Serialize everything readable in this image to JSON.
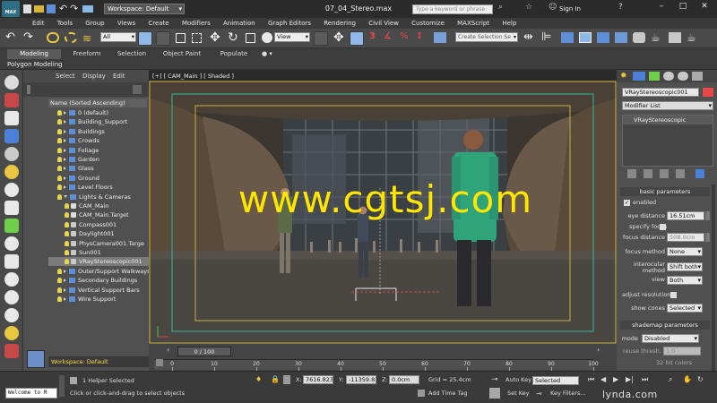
{
  "titlebar": {
    "app": "MAX",
    "workspace": "Workspace: Default",
    "filename": "07_04_Stereo.max",
    "search_placeholder": "Type a keyword or phrase",
    "signin": "Sign In"
  },
  "menu": [
    "Edit",
    "Tools",
    "Group",
    "Views",
    "Create",
    "Modifiers",
    "Animation",
    "Graph Editors",
    "Rendering",
    "Civil View",
    "Customize",
    "MAXScript",
    "Help"
  ],
  "toolbar": {
    "filter": "All",
    "refcoord": "View",
    "selset": "Create Selection Se"
  },
  "ribbon": {
    "tabs": [
      "Modeling",
      "Freeform",
      "Selection",
      "Object Paint",
      "Populate"
    ],
    "sub": "Polygon Modeling"
  },
  "explorer": {
    "tabs": [
      "Select",
      "Display",
      "Edit"
    ],
    "header": "Name (Sorted Ascending)",
    "workspace": "Workspace: Default",
    "items": [
      {
        "label": "0 (default)",
        "depth": 1,
        "icon": "layer"
      },
      {
        "label": "Building_Support",
        "depth": 1,
        "icon": "layer"
      },
      {
        "label": "Buildings",
        "depth": 1,
        "icon": "layer"
      },
      {
        "label": "Crowds",
        "depth": 1,
        "icon": "layer"
      },
      {
        "label": "Foliage",
        "depth": 1,
        "icon": "layer"
      },
      {
        "label": "Garden",
        "depth": 1,
        "icon": "layer"
      },
      {
        "label": "Glass",
        "depth": 1,
        "icon": "layer"
      },
      {
        "label": "Ground",
        "depth": 1,
        "icon": "layer"
      },
      {
        "label": "Level Floors",
        "depth": 1,
        "icon": "layer"
      },
      {
        "label": "Lights & Cameras",
        "depth": 1,
        "icon": "layer",
        "open": true
      },
      {
        "label": "CAM_Main",
        "depth": 2,
        "icon": "camera"
      },
      {
        "label": "CAM_Main.Target",
        "depth": 2,
        "icon": "camera"
      },
      {
        "label": "Compass001",
        "depth": 2,
        "icon": "helper"
      },
      {
        "label": "Daylight001",
        "depth": 2,
        "icon": "helper"
      },
      {
        "label": "PhysCamera001.Targe",
        "depth": 2,
        "icon": "helper"
      },
      {
        "label": "Sun001",
        "depth": 2,
        "icon": "helper"
      },
      {
        "label": "VRayStereoscopic001",
        "depth": 2,
        "icon": "helper",
        "selected": true
      },
      {
        "label": "Outer/Support Walkways",
        "depth": 1,
        "icon": "layer"
      },
      {
        "label": "Secondary Buildings",
        "depth": 1,
        "icon": "layer"
      },
      {
        "label": "Vertical Support Bars",
        "depth": 1,
        "icon": "layer"
      },
      {
        "label": "Wire Support",
        "depth": 1,
        "icon": "layer"
      }
    ]
  },
  "viewport": {
    "label": "[+] [ CAM_Main ] [ Shaded ]",
    "watermark": "www.cgtsj.com"
  },
  "panel": {
    "object_name": "VRayStereoscopic001",
    "modifier_list": "Modifier List",
    "stack_item": "VRayStereoscopic",
    "basic_title": "basic parameters",
    "enabled": "enabled",
    "eye_label": "eye distance",
    "eye_value": "16.51cm",
    "specify_focus": "specify focus",
    "focus_label": "focus distance",
    "focus_value": "508.0cm",
    "focus_method_label": "focus method",
    "focus_method": "None",
    "interocular_label": "interocular method",
    "interocular": "Shift both",
    "view_label": "view",
    "view": "Both",
    "adjust_label": "adjust resolution",
    "cones_label": "show cones",
    "cones": "Selected",
    "shademap_title": "shademap parameters",
    "mode_label": "mode",
    "mode": "Disabled",
    "reuse_label": "reuse thresh.",
    "reuse": "1.0",
    "bits": "32 bit colors"
  },
  "timeline": {
    "frame": "0 / 100",
    "ticks": [
      "0",
      "10",
      "20",
      "30",
      "40",
      "50",
      "60",
      "70",
      "80",
      "90",
      "100"
    ]
  },
  "status": {
    "listener": "Welcome to M",
    "selected": "1 Helper Selected",
    "prompt": "Click or click-and-drag to select objects",
    "x_label": "X:",
    "x": "7616.823c",
    "y_label": "Y:",
    "y": "-11359.814",
    "z_label": "Z:",
    "z": "0.0cm",
    "grid": "Grid = 25.4cm",
    "add_time_tag": "Add Time Tag",
    "auto_key": "Auto Key",
    "set_key": "Set Key",
    "selected_dd": "Selected",
    "key_filters": "Key Filters...",
    "lynda": "lynda.com"
  }
}
